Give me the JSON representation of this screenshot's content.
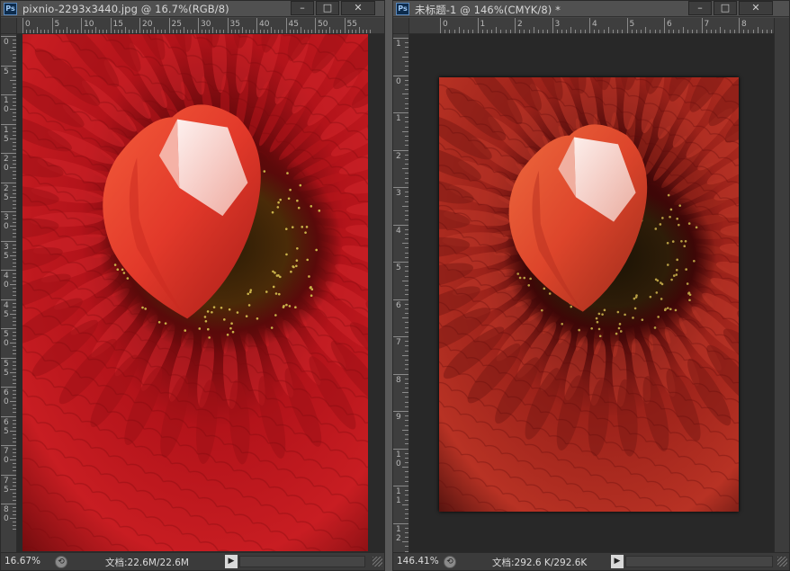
{
  "windows": [
    {
      "app_icon": "Ps",
      "title": "pixnio-2293x3440.jpg @ 16.7%(RGB/8)",
      "buttons": {
        "minimize": "–",
        "maximize": "□",
        "close": "✕"
      },
      "ruler_h_ticks": [
        "0",
        "5",
        "10",
        "15",
        "20",
        "25",
        "30",
        "35",
        "40",
        "45",
        "50",
        "55"
      ],
      "ruler_v_ticks": [
        "0",
        "5",
        "1\n0",
        "1\n5",
        "2\n0",
        "2\n5",
        "3\n0",
        "3\n5",
        "4\n0",
        "4\n5",
        "5\n0",
        "5\n5",
        "6\n0",
        "6\n5",
        "7\n0",
        "7\n5",
        "8\n0"
      ],
      "zoom": "16.67%",
      "doc_info": "文档:22.6M/22.6M"
    },
    {
      "app_icon": "Ps",
      "title": "未标题-1 @ 146%(CMYK/8) *",
      "buttons": {
        "minimize": "–",
        "maximize": "□",
        "close": "✕"
      },
      "ruler_h_ticks": [
        "0",
        "1",
        "2",
        "3",
        "4",
        "5",
        "6",
        "7",
        "8"
      ],
      "ruler_v_ticks": [
        "1",
        "0",
        "1",
        "2",
        "3",
        "4",
        "5",
        "6",
        "7",
        "8",
        "9",
        "1\n0",
        "1\n1",
        "1\n2"
      ],
      "zoom": "146.41%",
      "doc_info": "文档:292.6 K/292.6K"
    }
  ],
  "icons": {
    "status": "status-circle-icon",
    "arrow": "right-arrow-icon",
    "grip": "resize-grip-icon"
  },
  "colors": {
    "petal_red": "#c4161c",
    "petal_dark": "#5a0608",
    "heart": "#e8442a",
    "ui_bg": "#474747",
    "canvas_bg": "#282828"
  }
}
